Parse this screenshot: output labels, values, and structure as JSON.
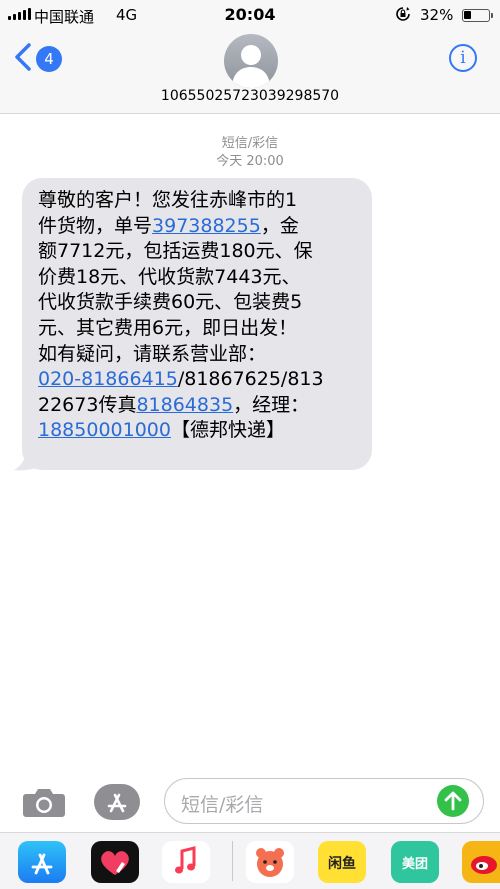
{
  "status_bar": {
    "carrier": "中国联通",
    "network": "4G",
    "time": "20:04",
    "battery_text": "32%",
    "battery_level": 0.32
  },
  "header": {
    "back_badge_count": "4",
    "sender_number": "10655025723039298570",
    "info_label": "i"
  },
  "conversation": {
    "service_label": "短信/彩信",
    "timestamp": "今天 20:00",
    "message": {
      "l1": "尊敬的客户！您发往赤峰市的1",
      "l2_a": "件货物，单号",
      "l2_link": "397388255",
      "l2_b": "，金",
      "l3": "额7712元，包括运费180元、保",
      "l4": "价费18元、代收货款7443元、",
      "l5": "代收货款手续费60元、包装费5",
      "l6": "元、其它费用6元，即日出发！",
      "l7": "如有疑问，请联系营业部：",
      "l8_link": "020-81866415",
      "l8_b": "/81867625/813",
      "l9_a": "22673传真",
      "l9_link": "81864835",
      "l9_b": "，经理：",
      "l10_link": "18850001000",
      "l10_b": "【德邦快递】"
    }
  },
  "input_bar": {
    "placeholder": "短信/彩信"
  },
  "app_drawer": {
    "apps": [
      {
        "name": "App Store",
        "icon": "appstore-icon"
      },
      {
        "name": "Digital Touch",
        "icon": "heart-touch-icon"
      },
      {
        "name": "Music",
        "icon": "music-note-icon"
      },
      {
        "name": "Bear",
        "icon": "bear-icon"
      },
      {
        "name": "闲鱼",
        "label": "闲鱼"
      },
      {
        "name": "美团",
        "label": "美团"
      },
      {
        "name": "Weibo",
        "icon": "weibo-icon"
      }
    ]
  },
  "colors": {
    "accent_blue": "#3478f6",
    "bubble_gray": "#e5e5ea",
    "link_blue": "#2a6bd6",
    "send_green": "#33c14a"
  }
}
